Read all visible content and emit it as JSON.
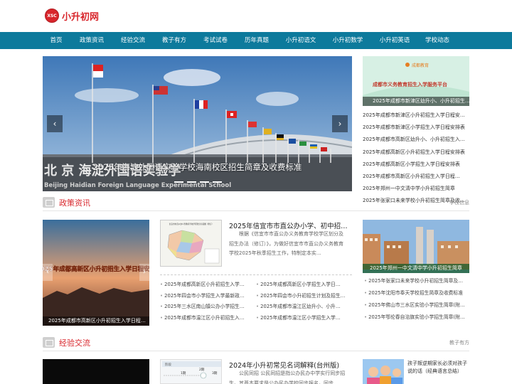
{
  "logo": {
    "badge": "XSC",
    "name": "小升初网"
  },
  "nav": [
    "首页",
    "政策资讯",
    "经验交流",
    "教子有方",
    "考试试卷",
    "历年真题",
    "小升初语文",
    "小升初数学",
    "小升初英语",
    "学校动态"
  ],
  "hero": {
    "caption": "2025年海淀外国语实验学校海南校区招生简章及收费标准",
    "building_text": "北 京 海淀外国语实验学",
    "building_pinyin": "Beijing  Haidian  Foreign  Language  Experimental  School",
    "prev": "‹",
    "next": "›"
  },
  "right_banner": {
    "brand": "成都教育",
    "title": "成都市义务教育招生入学服务平台",
    "caption": "2025年成都市新津区幼升小、小升初招生…"
  },
  "right_list": [
    "2025年成都市新津区小升初招生入学日程安…",
    "2025年成都市新津区小学招生入学日程安排表",
    "2025年成都市高新区幼升小、小升初招生入…",
    "2025年成都高新区小升初招生入学日程安排表",
    "2025年成都高新区小学招生入学日程安排表",
    "2025年成都市高新区小升初招生入学日程…",
    "2025年郑州一中文清中学小升初招生简章",
    "2025年张家口未来学校小升初招生简章及收…"
  ],
  "section1": {
    "title": "政策资讯",
    "more": "学校信息",
    "thumb": {
      "overlay": "2025年成都高新区小升初招生入学日程安排",
      "caption": "2025年成都市高新区小升初招生入学日程…"
    },
    "article": {
      "title": "2025年信宜市市直公办小学、初中招…",
      "desc": "根据《信宜市市直公办义务教育学校学区划分及招生办法（修订）》，为做好信宜市市直公办义务教育学校2025年秋季招生工作，特制定本实…",
      "map_title": "信宜市市直公办义务教育学校学区划分示意图（修订）"
    },
    "list_left": [
      "2025年成都高新区小升初招生入学…",
      "2025年四会市小学招生入学最新政…",
      "2025年三水区南山镇公办小学招生…",
      "2025年成都市温江区小升初招生入…"
    ],
    "list_right": [
      "2025年成都高新区小学招生入学日…",
      "2025年四会市小升初招生计划及招生…",
      "2025年成都市温江区幼升小、小升…",
      "2025年成都市温江区小学招生入学…"
    ],
    "right_thumb_caption": "2025年郑州一中文清中学小升初招生简章",
    "right_list": [
      "2025年张家口未来学校小升初招生简章及…",
      "2025年沈阳市奉天学校招生简章及收费标准",
      "2025年佛山市三水区实验小学招生简章(附…",
      "2025年鄂伦春自治旗实验小学招生简章(附…"
    ]
  },
  "section2": {
    "title": "经验交流",
    "more": "教子有方",
    "article": {
      "title": "2024年小升初常见名词解释(台州版)",
      "desc": "公民同招     公民同招是指公办民办中学实行同步招生。其基本要求是公办民办学校同步报名，同步…"
    },
    "flow": {
      "step_label": "阶段",
      "steps": [
        "1期",
        "2期",
        "3期"
      ]
    },
    "right_item": "孩子叛逆期家长必须对孩子说的话（经典语言总结）"
  },
  "colors": {
    "nav_bg": "#0d7a9c",
    "accent": "#d8262c"
  }
}
